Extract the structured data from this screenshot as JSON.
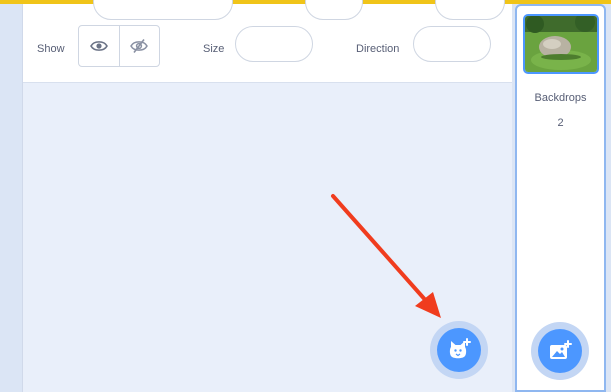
{
  "sprite_info": {
    "show_label": "Show",
    "size_label": "Size",
    "size_value": "",
    "direction_label": "Direction",
    "direction_value": ""
  },
  "icons": {
    "show": "eye-icon",
    "hide": "eye-slash-icon",
    "choose_sprite": "cat-plus-icon",
    "choose_backdrop": "image-plus-icon",
    "arrow": "red-arrow"
  },
  "stage": {
    "backdrops_label": "Backdrops",
    "backdrops_count": "2"
  },
  "colors": {
    "accent": "#4c97ff",
    "top_bar": "#f0c419",
    "arrow": "#f03c1e"
  }
}
